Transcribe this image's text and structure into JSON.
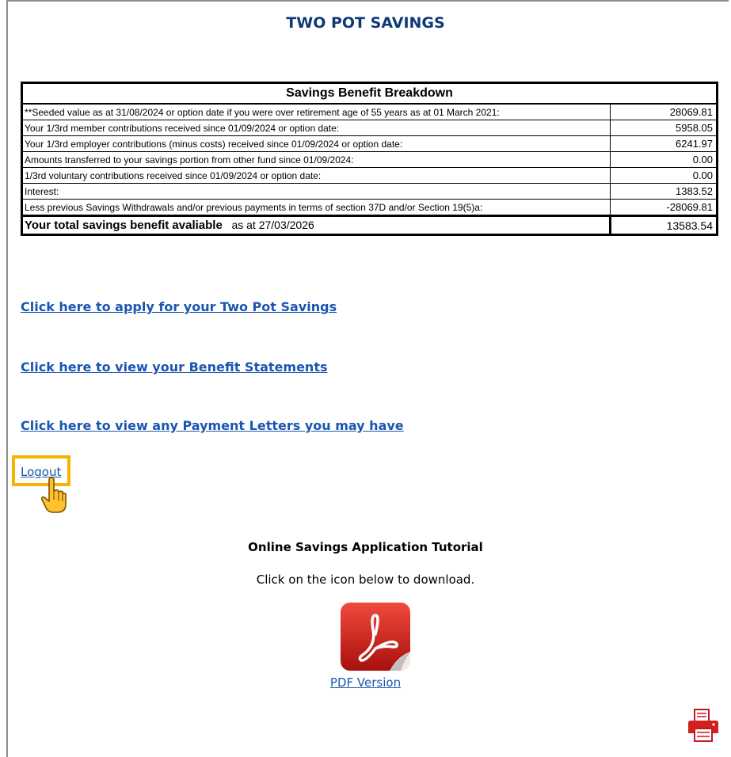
{
  "header": {
    "title": "TWO POT SAVINGS"
  },
  "breakdown": {
    "heading": "Savings Benefit Breakdown",
    "rows": [
      {
        "label": "**Seeded value as at 31/08/2024 or option date if you were over retirement age of 55 years as at 01 March 2021:",
        "value": "28069.81"
      },
      {
        "label": "Your 1/3rd member contributions received since 01/09/2024 or option date:",
        "value": "5958.05"
      },
      {
        "label": "Your 1/3rd employer contributions (minus costs) received since 01/09/2024 or option date:",
        "value": "6241.97"
      },
      {
        "label": "Amounts transferred to your savings portion from other fund since 01/09/2024:",
        "value": "0.00"
      },
      {
        "label": "1/3rd voluntary contributions received since 01/09/2024 or option date:",
        "value": "0.00"
      },
      {
        "label": "Interest:",
        "value": "1383.52"
      },
      {
        "label": "Less previous Savings Withdrawals and/or previous payments in terms of section 37D and/or Section 19(5)a:",
        "value": "-28069.81"
      }
    ],
    "total_label": "Your total savings benefit avaliable",
    "total_date": "as at 27/03/2026",
    "total_value": "13583.54"
  },
  "links": {
    "apply": "Click here to apply for your Two Pot Savings",
    "statements": "Click here to view your Benefit Statements",
    "letters": "Click here to view any Payment Letters you may have",
    "logout": "Logout"
  },
  "tutorial": {
    "title": "Online Savings Application Tutorial",
    "subtitle": "Click on the icon below to download.",
    "pdf_label": "PDF Version",
    "pdf_icon": "adobe-pdf-icon"
  },
  "icons": {
    "pointer": "hand-pointer-icon",
    "print": "printer-icon"
  },
  "colors": {
    "title": "#0f3b75",
    "link": "#1a56b0",
    "highlight": "#f5b400",
    "pdf_red": "#d2211c"
  }
}
